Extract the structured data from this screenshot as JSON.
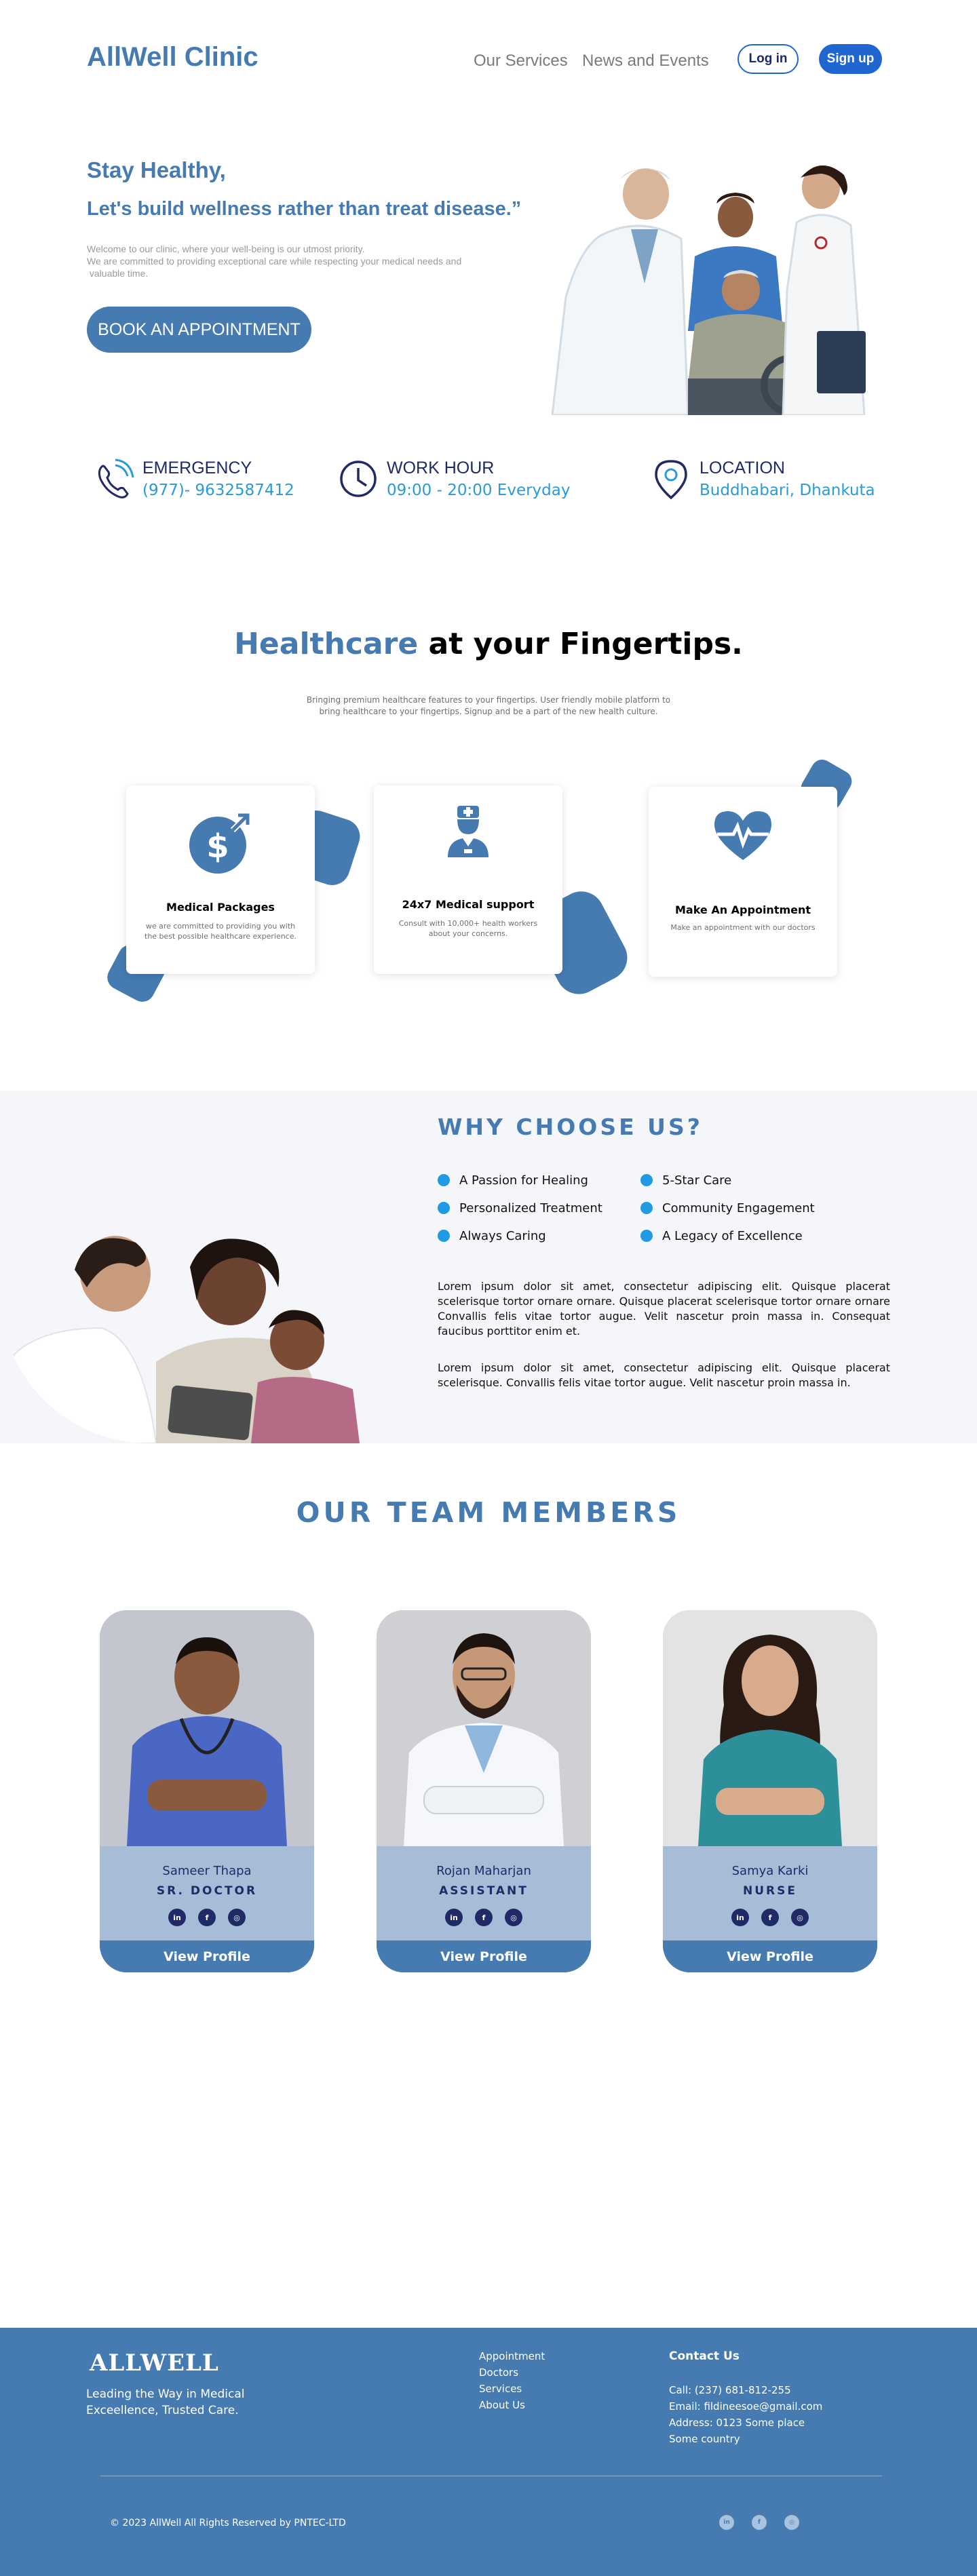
{
  "nav": {
    "brand": "AllWell Clinic",
    "links": [
      "Our Services",
      "News and Events"
    ],
    "login": "Log in",
    "signup": "Sign up"
  },
  "hero": {
    "kicker": "Stay Healthy,",
    "title": "Let's build wellness rather than treat disease.”",
    "desc_lines": [
      "Welcome to our clinic, where your well-being is our utmost priority.",
      "We are committed to providing exceptional care while respecting your medical needs and",
      " valuable time."
    ],
    "cta": "BOOK AN APPOINTMENT"
  },
  "info": [
    {
      "label": "EMERGENCY",
      "value": "(977)- 9632587412",
      "icon": "phone-icon"
    },
    {
      "label": "WORK HOUR",
      "value": "09:00 - 20:00 Everyday",
      "icon": "clock-icon"
    },
    {
      "label": "LOCATION",
      "value": "Buddhabari, Dhankuta",
      "icon": "location-pin-icon"
    }
  ],
  "fingertips": {
    "title_highlight": "Healthcare",
    "title_rest": " at your Fingertips.",
    "subtitle_lines": [
      "Bringing premium healthcare features to your fingertips. User friendly mobile platform to",
      "bring healthcare to your fingertips. Signup and be a part of the new health culture."
    ],
    "cards": [
      {
        "title": "Medical Packages",
        "text": "we are committed to providing you with the best possible healthcare experience.",
        "icon": "money-growth-icon"
      },
      {
        "title": "24x7 Medical support",
        "text": "Consult with 10,000+ health workers about your concerns.",
        "icon": "doctor-icon"
      },
      {
        "title": "Make An Appointment",
        "text": "Make an appointment with our doctors",
        "icon": "heartbeat-icon"
      }
    ]
  },
  "why": {
    "title": "WHY CHOOSE US?",
    "left_items": [
      "A Passion for Healing",
      "Personalized Treatment",
      "Always Caring"
    ],
    "right_items": [
      "5-Star Care",
      "Community Engagement",
      "A Legacy of Excellence"
    ],
    "para1": "Lorem ipsum dolor sit amet, consectetur adipiscing elit. Quisque placerat scelerisque tortor ornare ornare. Quisque placerat scelerisque tortor ornare ornare Convallis felis vitae tortor augue. Velit nascetur proin massa in. Consequat faucibus porttitor enim et.",
    "para2": "Lorem ipsum dolor sit amet, consectetur adipiscing elit. Quisque placerat scelerisque. Convallis felis vitae tortor augue. Velit nascetur proin massa in."
  },
  "team": {
    "title": "OUR TEAM MEMBERS",
    "members": [
      {
        "name": "Sameer Thapa",
        "role": "SR. DOCTOR",
        "button": "View Profile"
      },
      {
        "name": "Rojan Maharjan",
        "role": "ASSISTANT",
        "button": "View Profile"
      },
      {
        "name": "Samya Karki",
        "role": "NURSE",
        "button": "View Profile"
      }
    ],
    "social": [
      "in",
      "f",
      "◎"
    ]
  },
  "footer": {
    "brand": "ALLWELL",
    "tagline_lines": [
      "Leading the Way in Medical",
      "Exceellence, Trusted Care."
    ],
    "links": [
      "Appointment",
      "Doctors",
      "Services",
      "About Us"
    ],
    "contact_heading": "Contact Us",
    "contact_lines": [
      "Call: (237) 681-812-255",
      "Email: fildineesoe@gmail.com",
      "Address: 0123 Some place",
      "Some country"
    ],
    "copyright": "© 2023 AllWell All Rights Reserved by PNTEC-LTD"
  }
}
